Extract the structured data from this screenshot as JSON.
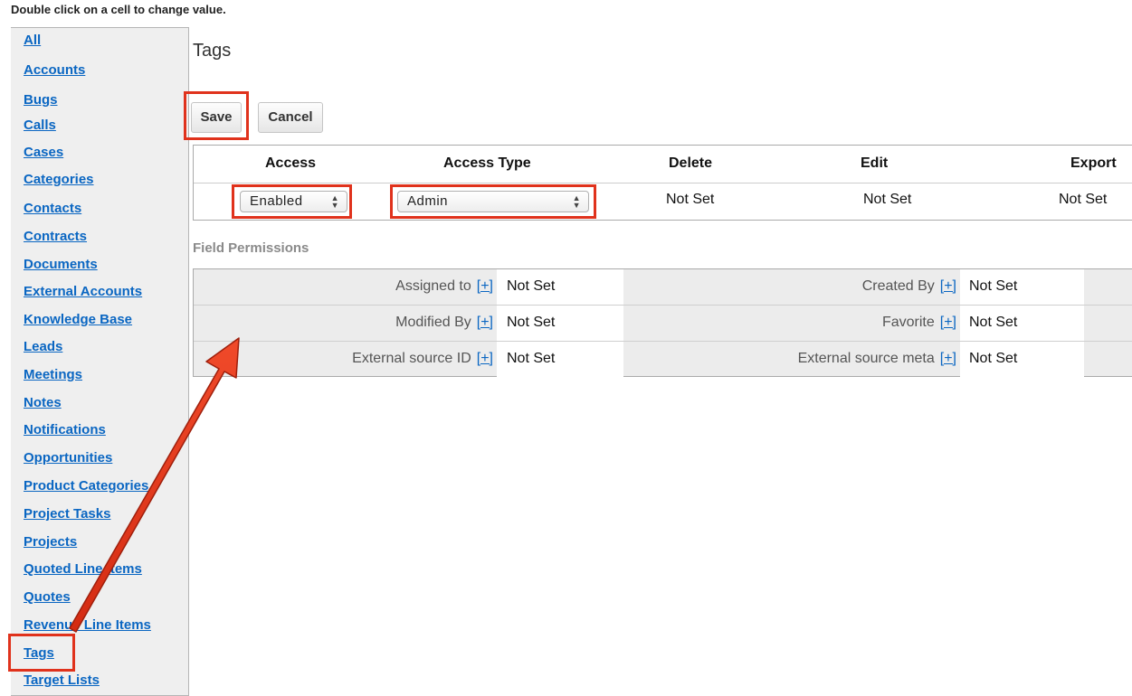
{
  "instruction": "Double click on a cell to change value.",
  "sidebar": {
    "items": [
      "All",
      "Accounts",
      "Bugs",
      "Calls",
      "Cases",
      "Categories",
      "Contacts",
      "Contracts",
      "Documents",
      "External Accounts",
      "Knowledge Base",
      "Leads",
      "Meetings",
      "Notes",
      "Notifications",
      "Opportunities",
      "Product Categories",
      "Project Tasks",
      "Projects",
      "Quoted Line Items",
      "Quotes",
      "Revenue Line Items",
      "Tags",
      "Target Lists"
    ]
  },
  "title": "Tags",
  "buttons": {
    "save": "Save",
    "cancel": "Cancel"
  },
  "acl": {
    "headers": {
      "access": "Access",
      "access_type": "Access Type",
      "delete": "Delete",
      "edit": "Edit",
      "export": "Export"
    },
    "row": {
      "access": "Enabled",
      "access_type": "Admin",
      "delete": "Not Set",
      "edit": "Not Set",
      "export": "Not Set"
    }
  },
  "field_permissions": {
    "label": "Field Permissions",
    "plus": "[+]",
    "rows": [
      {
        "left_label": "Assigned to",
        "left_value": "Not Set",
        "right_label": "Created By",
        "right_value": "Not Set"
      },
      {
        "left_label": "Modified By",
        "left_value": "Not Set",
        "right_label": "Favorite",
        "right_value": "Not Set"
      },
      {
        "left_label": "External source ID",
        "left_value": "Not Set",
        "right_label": "External source meta",
        "right_value": "Not Set"
      }
    ]
  },
  "colors": {
    "highlight": "#e0321c",
    "link": "#0a66c2"
  },
  "icons": {
    "select_arrows": "updown-arrows-icon",
    "annotation": "arrow-annotation-icon"
  }
}
